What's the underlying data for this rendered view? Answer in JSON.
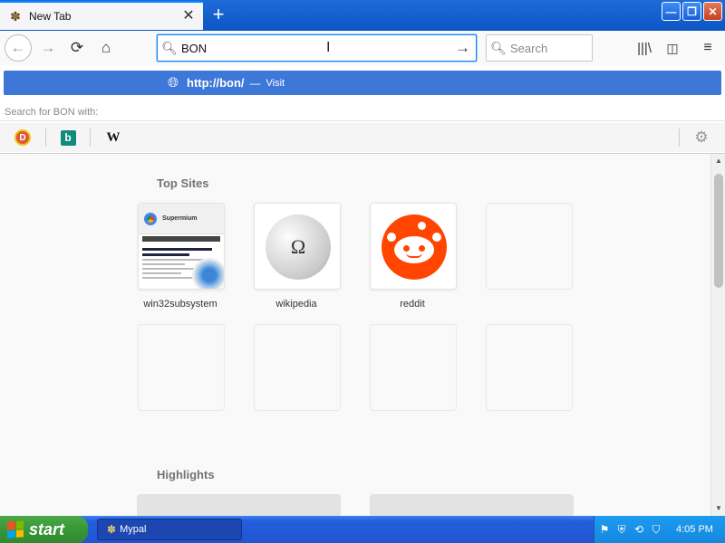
{
  "tab": {
    "title": "New Tab",
    "favicon": "bee-icon",
    "close": "✕"
  },
  "new_tab": "+",
  "window_buttons": {
    "minimize": "—",
    "restore": "❐",
    "close": "✕"
  },
  "nav": {
    "back": "←",
    "forward": "→",
    "reload": "⟳",
    "home": "⌂",
    "library": "|||\\",
    "sidebar": "◫",
    "menu": "≡"
  },
  "urlbar": {
    "value": "BON",
    "go": "→"
  },
  "searchbar": {
    "placeholder": "Search"
  },
  "autocomplete": {
    "url": "http://bon/",
    "separator": "—",
    "action": "Visit",
    "search_for": "Search for BON with:",
    "engines": [
      {
        "name": "DuckDuckGo",
        "glyph": "D"
      },
      {
        "name": "Bing",
        "glyph": "b"
      },
      {
        "name": "Wikipedia",
        "glyph": "W"
      }
    ],
    "settings": "⚙"
  },
  "top_sites": {
    "title": "Top Sites",
    "sites": [
      {
        "label": "win32subsystem",
        "thumb_title": "Supermium"
      },
      {
        "label": "wikipedia",
        "thumb_glyph": "Ω"
      },
      {
        "label": "reddit"
      }
    ]
  },
  "highlights": {
    "title": "Highlights"
  },
  "taskbar": {
    "start": "start",
    "task": "Mypal",
    "clock": "4:05 PM",
    "colors": {
      "start_green": "#3a9a38",
      "taskbar_blue": "#245edc"
    }
  },
  "colors": {
    "accent": "#0a84ff",
    "suggest_bg": "#3d78d8",
    "reddit": "#ff4500"
  }
}
